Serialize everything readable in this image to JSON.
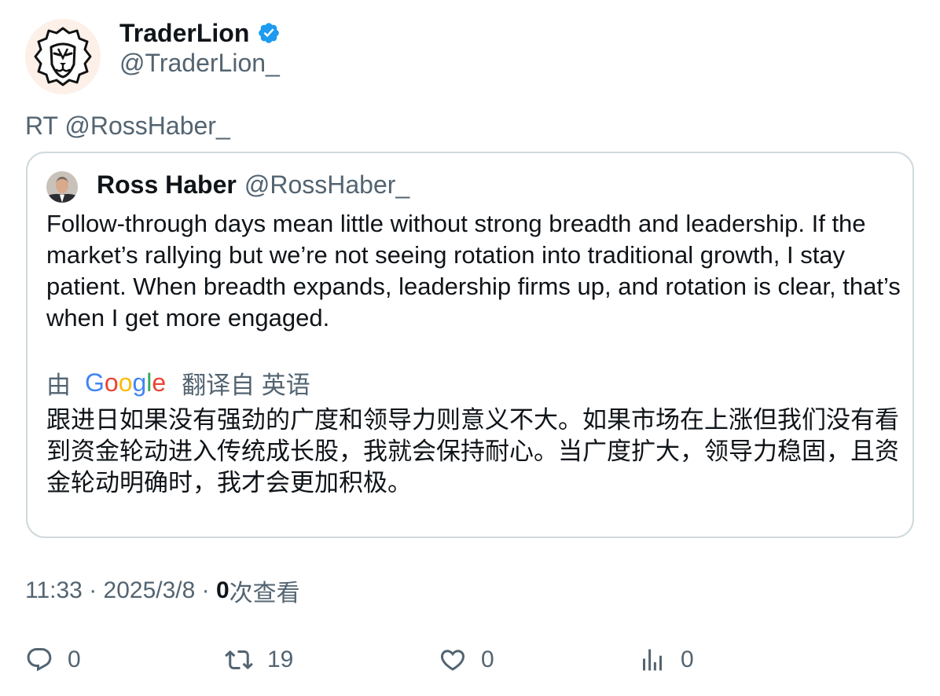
{
  "author": {
    "display_name": "TraderLion",
    "handle": "@TraderLion_",
    "verified": true,
    "avatar_icon": "lion-logo-icon"
  },
  "retweet_line": "RT @RossHaber_",
  "quoted": {
    "display_name": "Ross Haber",
    "handle": "@RossHaber_",
    "avatar_icon": "profile-photo",
    "text": "Follow-through days mean little without strong breadth and leadership. If the market’s rallying but we’re not seeing rotation into traditional growth, I stay patient. When breadth expands, leadership firms up, and rotation is clear, that’s when I get more engaged.",
    "translation_by": "由",
    "translation_service": "Google",
    "translation_from": "翻译自 英语",
    "translation_text": "跟进日如果没有强劲的广度和领导力则意义不大。如果市场在上涨但我们没有看到资金轮动进入传统成长股，我就会保持耐心。当广度扩大，领导力稳固，且资金轮动明确时，我才会更加积极。"
  },
  "meta": {
    "time": "11:33",
    "separator": " · ",
    "date": "2025/3/8",
    "views_count": "0",
    "views_label": "次查看"
  },
  "actions": {
    "replies": "0",
    "retweets": "19",
    "likes": "0",
    "views": "0"
  },
  "colors": {
    "primary_text": "#0f1419",
    "secondary_text": "#536471",
    "verified_blue": "#1d9bf0",
    "card_border": "#cfd9de"
  }
}
